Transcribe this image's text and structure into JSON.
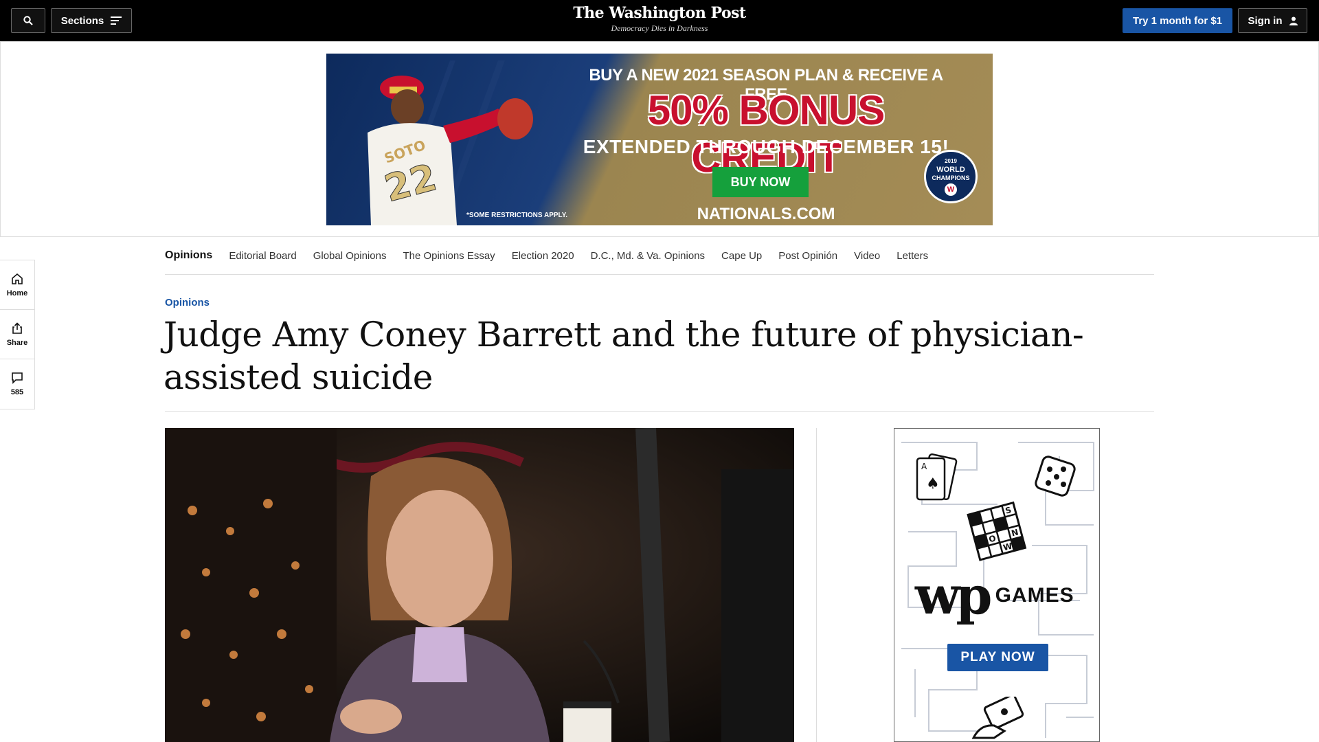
{
  "header": {
    "sections_label": "Sections",
    "logo_name": "The Washington Post",
    "logo_tagline": "Democracy Dies in Darkness",
    "try_label": "Try 1 month for $1",
    "signin_label": "Sign in"
  },
  "ad_banner": {
    "line1": "BUY A NEW 2021 SEASON PLAN & RECEIVE A FREE",
    "line2": "50% BONUS CREDIT",
    "line3": "EXTENDED THROUGH DECEMBER 15!",
    "buy_label": "BUY NOW",
    "url": "NATIONALS.COM",
    "restrictions": "*SOME RESTRICTIONS APPLY.",
    "badge_year": "2019",
    "badge_line1": "WORLD",
    "badge_line2": "CHAMPIONS",
    "jersey_name": "SOTO",
    "jersey_number": "22"
  },
  "subnav": {
    "items": [
      "Opinions",
      "Editorial Board",
      "Global Opinions",
      "The Opinions Essay",
      "Election 2020",
      "D.C., Md. & Va. Opinions",
      "Cape Up",
      "Post Opinión",
      "Video",
      "Letters"
    ]
  },
  "rail": {
    "home_label": "Home",
    "share_label": "Share",
    "comments_count": "585"
  },
  "article": {
    "kicker": "Opinions",
    "headline": "Judge Amy Coney Barrett and the future of physician-assisted suicide"
  },
  "games_ad": {
    "brand": "wp",
    "games_label": "GAMES",
    "play_label": "PLAY NOW",
    "card_rank": "A",
    "crossword_letters": [
      "S",
      "O",
      "N",
      "W"
    ]
  },
  "colors": {
    "topbar_bg": "#000000",
    "accent_blue": "#1955a5",
    "ad_red": "#c8102e",
    "ad_green": "#15a03c"
  }
}
